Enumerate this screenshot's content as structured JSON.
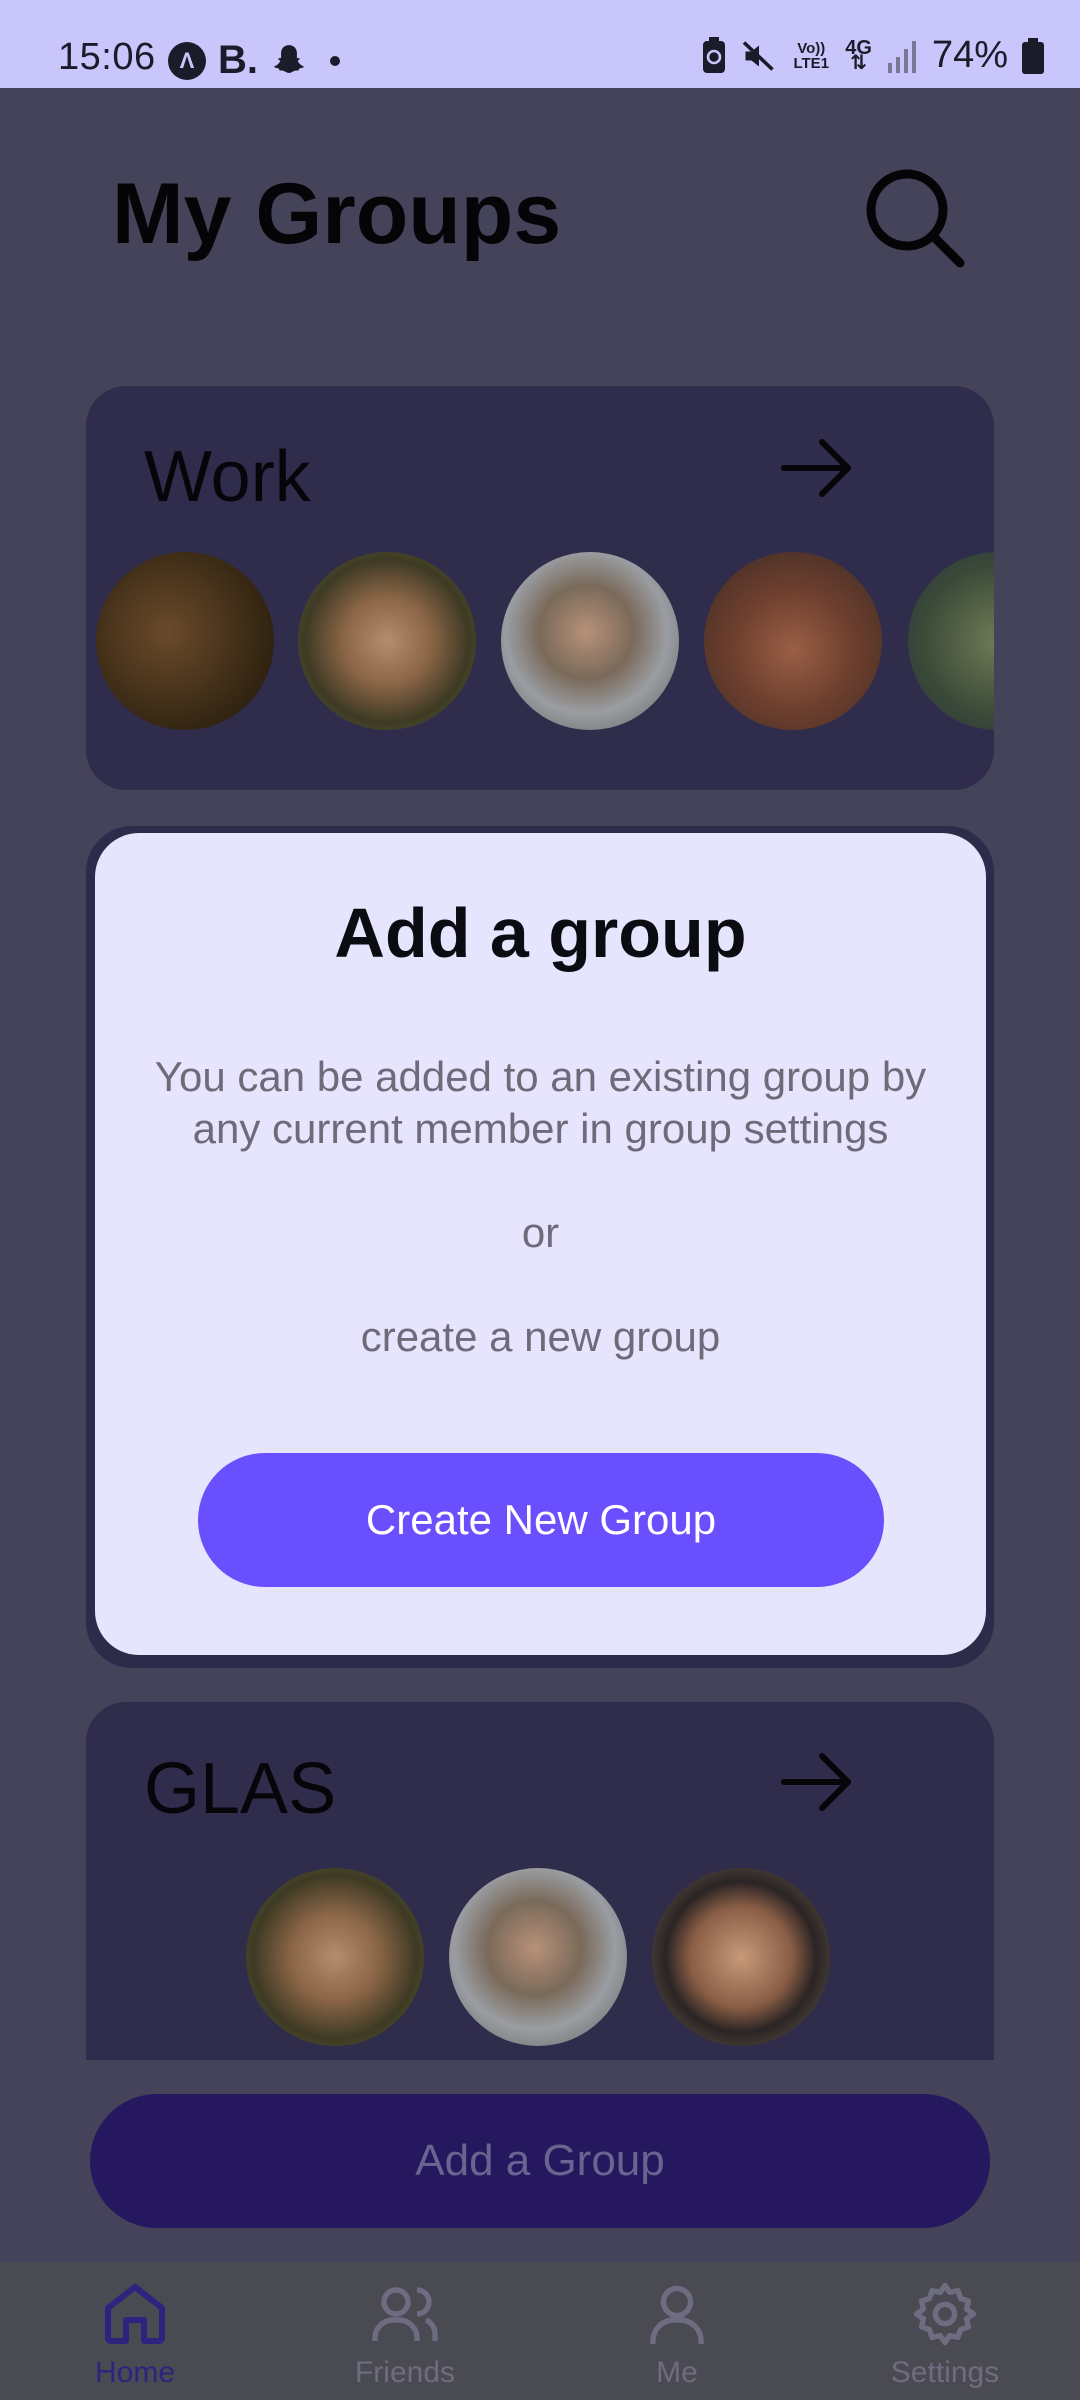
{
  "status_bar": {
    "time": "15:06",
    "left_icons": [
      "app-a-icon",
      "b-app-icon",
      "snapchat-icon",
      "dot-icon"
    ],
    "b_text": "B.",
    "volte_text": "Vo)) LTE1",
    "network_text": "4G",
    "battery_text": "74%"
  },
  "header": {
    "title": "My Groups",
    "search_icon": "search-icon"
  },
  "groups": [
    {
      "name": "Work",
      "members": 5
    },
    {
      "name": "GLAS",
      "members": 3
    }
  ],
  "modal": {
    "title": "Add a group",
    "body": "You can be added to an existing group by any current member in group settings",
    "or_text": "or",
    "create_text": "create a new group",
    "button_label": "Create New Group"
  },
  "add_group_button": "Add a Group",
  "nav": {
    "items": [
      {
        "label": "Home",
        "icon": "home-icon",
        "active": true
      },
      {
        "label": "Friends",
        "icon": "friends-icon",
        "active": false
      },
      {
        "label": "Me",
        "icon": "person-icon",
        "active": false
      },
      {
        "label": "Settings",
        "icon": "gear-icon",
        "active": false
      }
    ]
  },
  "colors": {
    "accent": "#6a4ffe",
    "status_bar": "#c8c6fb",
    "modal_bg": "#e6e5fd",
    "overlay_bg": "#44435a"
  }
}
